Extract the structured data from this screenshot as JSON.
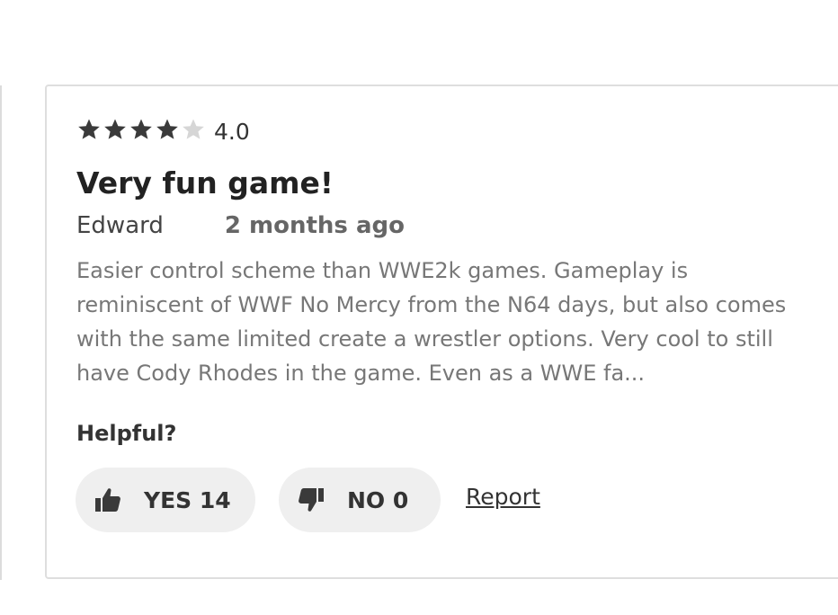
{
  "review": {
    "rating": {
      "stars_filled": 4,
      "stars_total": 5,
      "value_text": "4.0"
    },
    "title": "Very fun game!",
    "author": "Edward",
    "date": "2 months ago",
    "body": "Easier control scheme than WWE2k games. Gameplay is reminiscent of WWF No Mercy from the N64 days, but also comes with the same limited create a wrestler options. Very cool to still have Cody Rhodes in the game. Even as a WWE fa...",
    "helpful": {
      "label": "Helpful?",
      "yes_label": "YES 14",
      "no_label": "NO 0",
      "report_label": "Report"
    }
  },
  "icons": {
    "star_filled": "star-icon",
    "star_empty": "star-empty-icon",
    "thumbs_up": "thumbs-up-icon",
    "thumbs_down": "thumbs-down-icon"
  },
  "colors": {
    "star_filled": "#3a3a3a",
    "star_empty": "#d6d6d6",
    "button_bg": "#efefef",
    "body_text": "#777777",
    "border": "#dedede"
  }
}
